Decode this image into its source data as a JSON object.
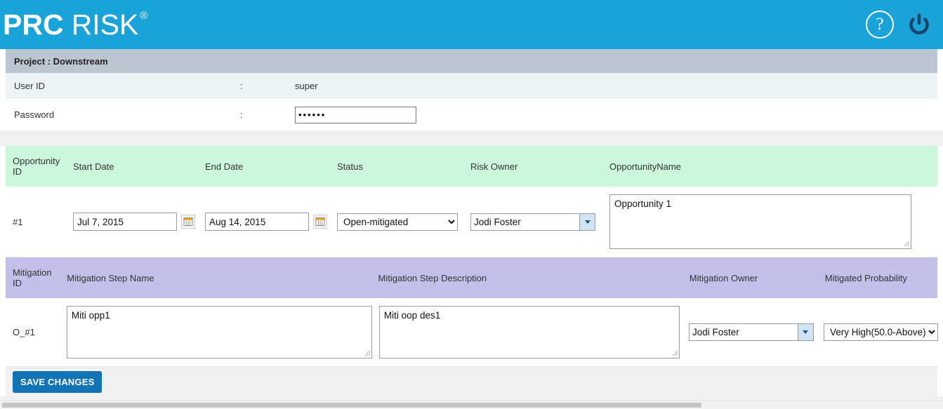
{
  "header": {
    "logo_primary": "PRC",
    "logo_secondary": "RISK",
    "logo_registered": "®",
    "help_label": "?",
    "help_icon": "question-circle-icon",
    "power_icon": "power-icon",
    "bar_color": "#19a3d8"
  },
  "project": {
    "title": "Project : Downstream"
  },
  "credentials": {
    "user_id_label": "User ID",
    "user_id_colon": ":",
    "user_id_value": "super",
    "password_label": "Password",
    "password_colon": ":",
    "password_value": "••••••"
  },
  "opportunity_grid": {
    "header_color": "#ccf7dd",
    "columns": [
      "Opportunity ID",
      "Start Date",
      "End Date",
      "Status",
      "Risk Owner",
      "OpportunityName"
    ],
    "row": {
      "id": "#1",
      "start_date": "Jul 7, 2015",
      "end_date": "Aug 14, 2015",
      "start_date_icon": "calendar-icon",
      "end_date_icon": "calendar-icon",
      "status": "Open-mitigated",
      "status_options": [
        "Open-mitigated"
      ],
      "risk_owner": "Jodi Foster",
      "opportunity_name": "Opportunity 1"
    }
  },
  "mitigation_grid": {
    "header_color": "#c3c0ea",
    "columns": [
      "Mitigation ID",
      "Mitigation Step Name",
      "Mitigation Step Description",
      "Mitigation Owner",
      "Mitigated Probability"
    ],
    "row": {
      "id": "O_#1",
      "step_name": "Miti opp1",
      "step_description": "Miti oop des1",
      "mitigation_owner": "Jodi Foster",
      "mitigated_probability": "Very High(50.0-Above)",
      "mitigated_probability_options": [
        "Very High(50.0-Above)"
      ]
    }
  },
  "footer": {
    "save_label": "SAVE CHANGES",
    "save_color": "#1273b5"
  }
}
